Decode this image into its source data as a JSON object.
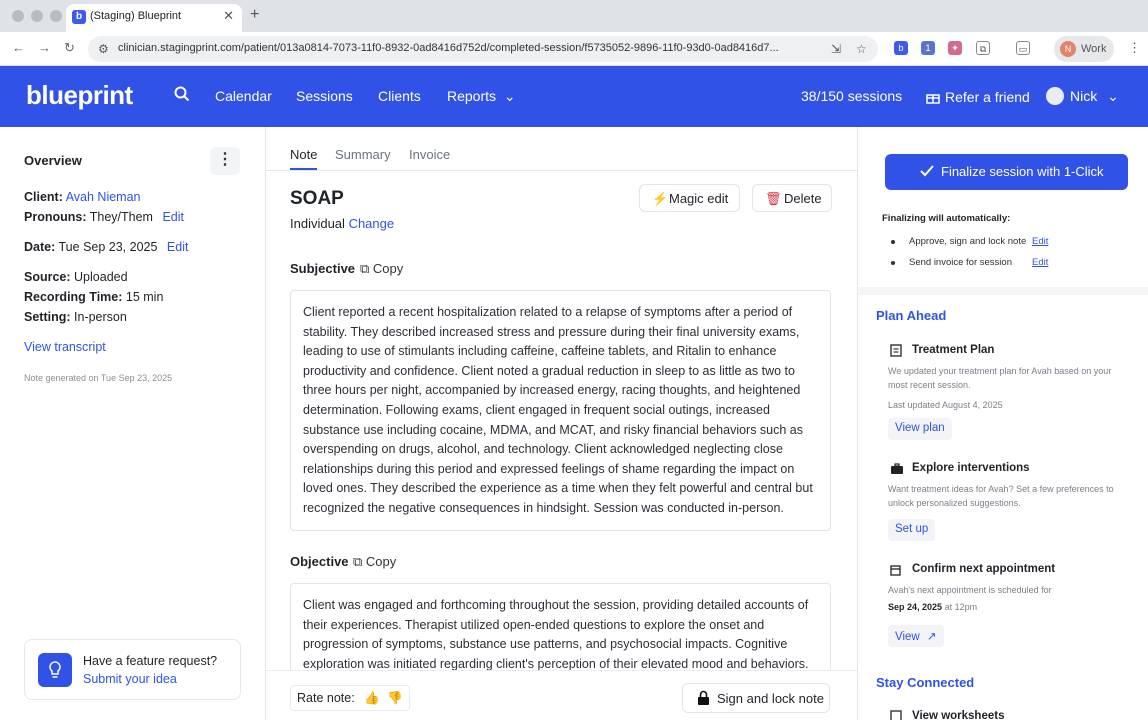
{
  "browser": {
    "tab_title": "(Staging) Blueprint",
    "url": "clinician.stagingprint.com/patient/013a0814-7073-11f0-8932-0ad8416d752d/completed-session/f5735052-9896-11f0-93d0-0ad8416d7...",
    "profile_label": "Work",
    "profile_initial": "N"
  },
  "header": {
    "logo": "blueprint",
    "nav": [
      "Calendar",
      "Sessions",
      "Clients",
      "Reports"
    ],
    "sessions_count": "38/150 sessions",
    "refer_label": "Refer a friend",
    "user_name": "Nick"
  },
  "overview": {
    "title": "Overview",
    "client_label": "Client:",
    "client_name": "Avah Nieman",
    "pronouns_label": "Pronouns:",
    "pronouns_value": "They/Them",
    "pronouns_edit": "Edit",
    "date_label": "Date:",
    "date_value": "Tue Sep 23, 2025",
    "date_edit": "Edit",
    "source_label": "Source:",
    "source_value": "Uploaded",
    "recording_label": "Recording Time:",
    "recording_value": "15 min",
    "setting_label": "Setting:",
    "setting_value": "In-person",
    "transcript_link": "View transcript",
    "note_generated": "Note generated on Tue Sep 23, 2025",
    "feature_title": "Have a feature request?",
    "feature_link": "Submit your idea"
  },
  "note": {
    "tabs": [
      "Note",
      "Summary",
      "Invoice"
    ],
    "title": "SOAP",
    "type_label": "Individual",
    "change_link": "Change",
    "magic_edit": "Magic edit",
    "delete": "Delete",
    "copy_label": "Copy",
    "subjective_heading": "Subjective",
    "subjective_text": "Client reported a recent hospitalization related to a relapse of symptoms after a period of stability. They described increased stress and pressure during their final university exams, leading to use of stimulants including caffeine, caffeine tablets, and Ritalin to enhance productivity and confidence. Client noted a gradual reduction in sleep to as little as two to three hours per night, accompanied by increased energy, racing thoughts, and heightened determination. Following exams, client engaged in frequent social outings, increased substance use including cocaine, MDMA, and MCAT, and risky financial behaviors such as overspending on drugs, alcohol, and technology. Client acknowledged neglecting close relationships during this period and expressed feelings of shame regarding the impact on loved ones. They described the experience as a time when they felt powerful and central but recognized the negative consequences in hindsight. Session was conducted in-person.",
    "objective_heading": "Objective",
    "objective_text": "Client was engaged and forthcoming throughout the session, providing detailed accounts of their experiences. Therapist utilized open-ended questions to explore the onset and progression of symptoms, substance use patterns, and psychosocial impacts. Cognitive exploration was initiated regarding client's perception of their elevated mood and behaviors.",
    "rate_label": "Rate note:",
    "sign_lock": "Sign and lock note"
  },
  "right": {
    "finalize_label": "Finalize session with 1-Click",
    "finalize_auto": "Finalizing will automatically:",
    "auto_items": [
      {
        "text": "Approve, sign and lock note",
        "edit": "Edit"
      },
      {
        "text": "Send invoice for session",
        "edit": "Edit"
      }
    ],
    "plan_ahead": "Plan Ahead",
    "treatment_title": "Treatment Plan",
    "treatment_desc": "We updated your treatment plan for Avah based on your most recent session.",
    "treatment_updated": "Last updated August 4, 2025",
    "treatment_btn": "View plan",
    "interventions_title": "Explore interventions",
    "interventions_desc": "Want treatment ideas for Avah? Set a few preferences to unlock personalized suggestions.",
    "interventions_btn": "Set up",
    "appt_title": "Confirm next appointment",
    "appt_desc": "Avah's next appointment is scheduled for",
    "appt_date": "Sep 24, 2025",
    "appt_at": "at",
    "appt_time": "12pm",
    "appt_btn": "View",
    "stay_connected": "Stay Connected",
    "worksheets": "View worksheets"
  },
  "colors": {
    "brand": "#3152e6",
    "link": "#3152e6"
  }
}
